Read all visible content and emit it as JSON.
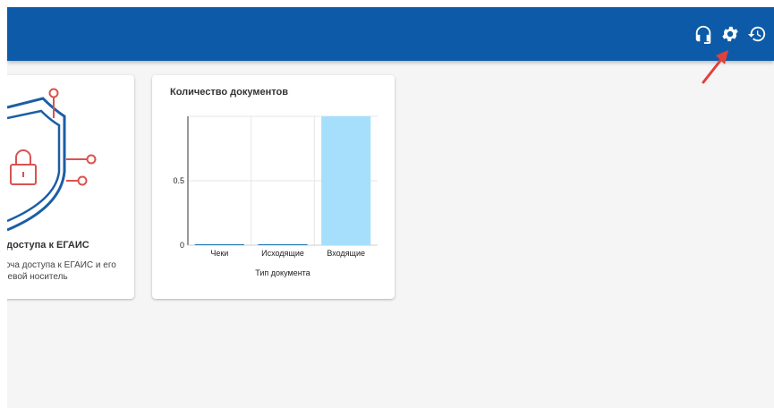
{
  "header": {
    "icons": [
      {
        "name": "headset-icon"
      },
      {
        "name": "gear-icon"
      },
      {
        "name": "history-icon"
      }
    ],
    "accent_color": "#0d5ba8"
  },
  "card_egais": {
    "title": "а доступа к ЕГАИС",
    "description_line1": "люча доступа к ЕГАИС и его",
    "description_line2": "очевой носитель",
    "icon": "shield-lock-illustration"
  },
  "card_documents": {
    "title": "Количество документов",
    "chart_data": {
      "type": "bar",
      "categories": [
        "Чеки",
        "Исходящие",
        "Входящие"
      ],
      "values": [
        0,
        0,
        1
      ],
      "xlabel": "Тип документа",
      "ylabel": "",
      "ylim": [
        0,
        1
      ],
      "y_ticks": [
        "0",
        "0.5"
      ],
      "grid": true,
      "bar_color": "#a6dffb"
    }
  },
  "annotation": {
    "type": "red-arrow",
    "target": "gear-icon",
    "color": "#e0413a"
  }
}
